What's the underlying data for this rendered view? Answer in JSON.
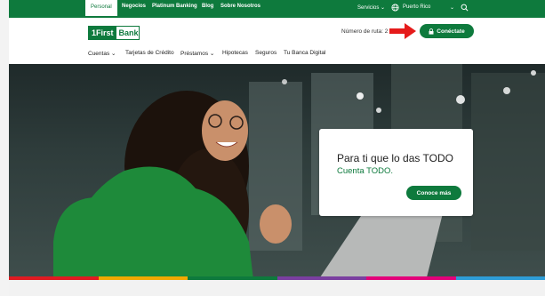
{
  "topbar": {
    "segments": [
      "Personal",
      "Negocios",
      "Platinum Banking",
      "Blog",
      "Sobre Nosotros"
    ],
    "services_label": "Servicios",
    "region_label": "Puerto Rico"
  },
  "header": {
    "logo_part1": "1First",
    "logo_part2": "Bank",
    "route_label": "Número de ruta: 2",
    "cta_label": "Conéctate"
  },
  "nav": {
    "items": [
      "Cuentas",
      "Tarjetas de Crédito",
      "Préstamos",
      "Hipotecas",
      "Seguros",
      "Tu Banca Digital"
    ]
  },
  "hero": {
    "title": "Para ti que lo das TODO",
    "subtitle": "Cuenta TODO.",
    "button_label": "Conoce más"
  },
  "colors": {
    "brand_green": "#0e7a3d",
    "annotation_red": "#e51b1b",
    "stripe_colors": [
      "#e01b22",
      "#f2a900",
      "#0e7a3d",
      "#7a3fa0",
      "#e2007a",
      "#2e9dd7"
    ]
  }
}
